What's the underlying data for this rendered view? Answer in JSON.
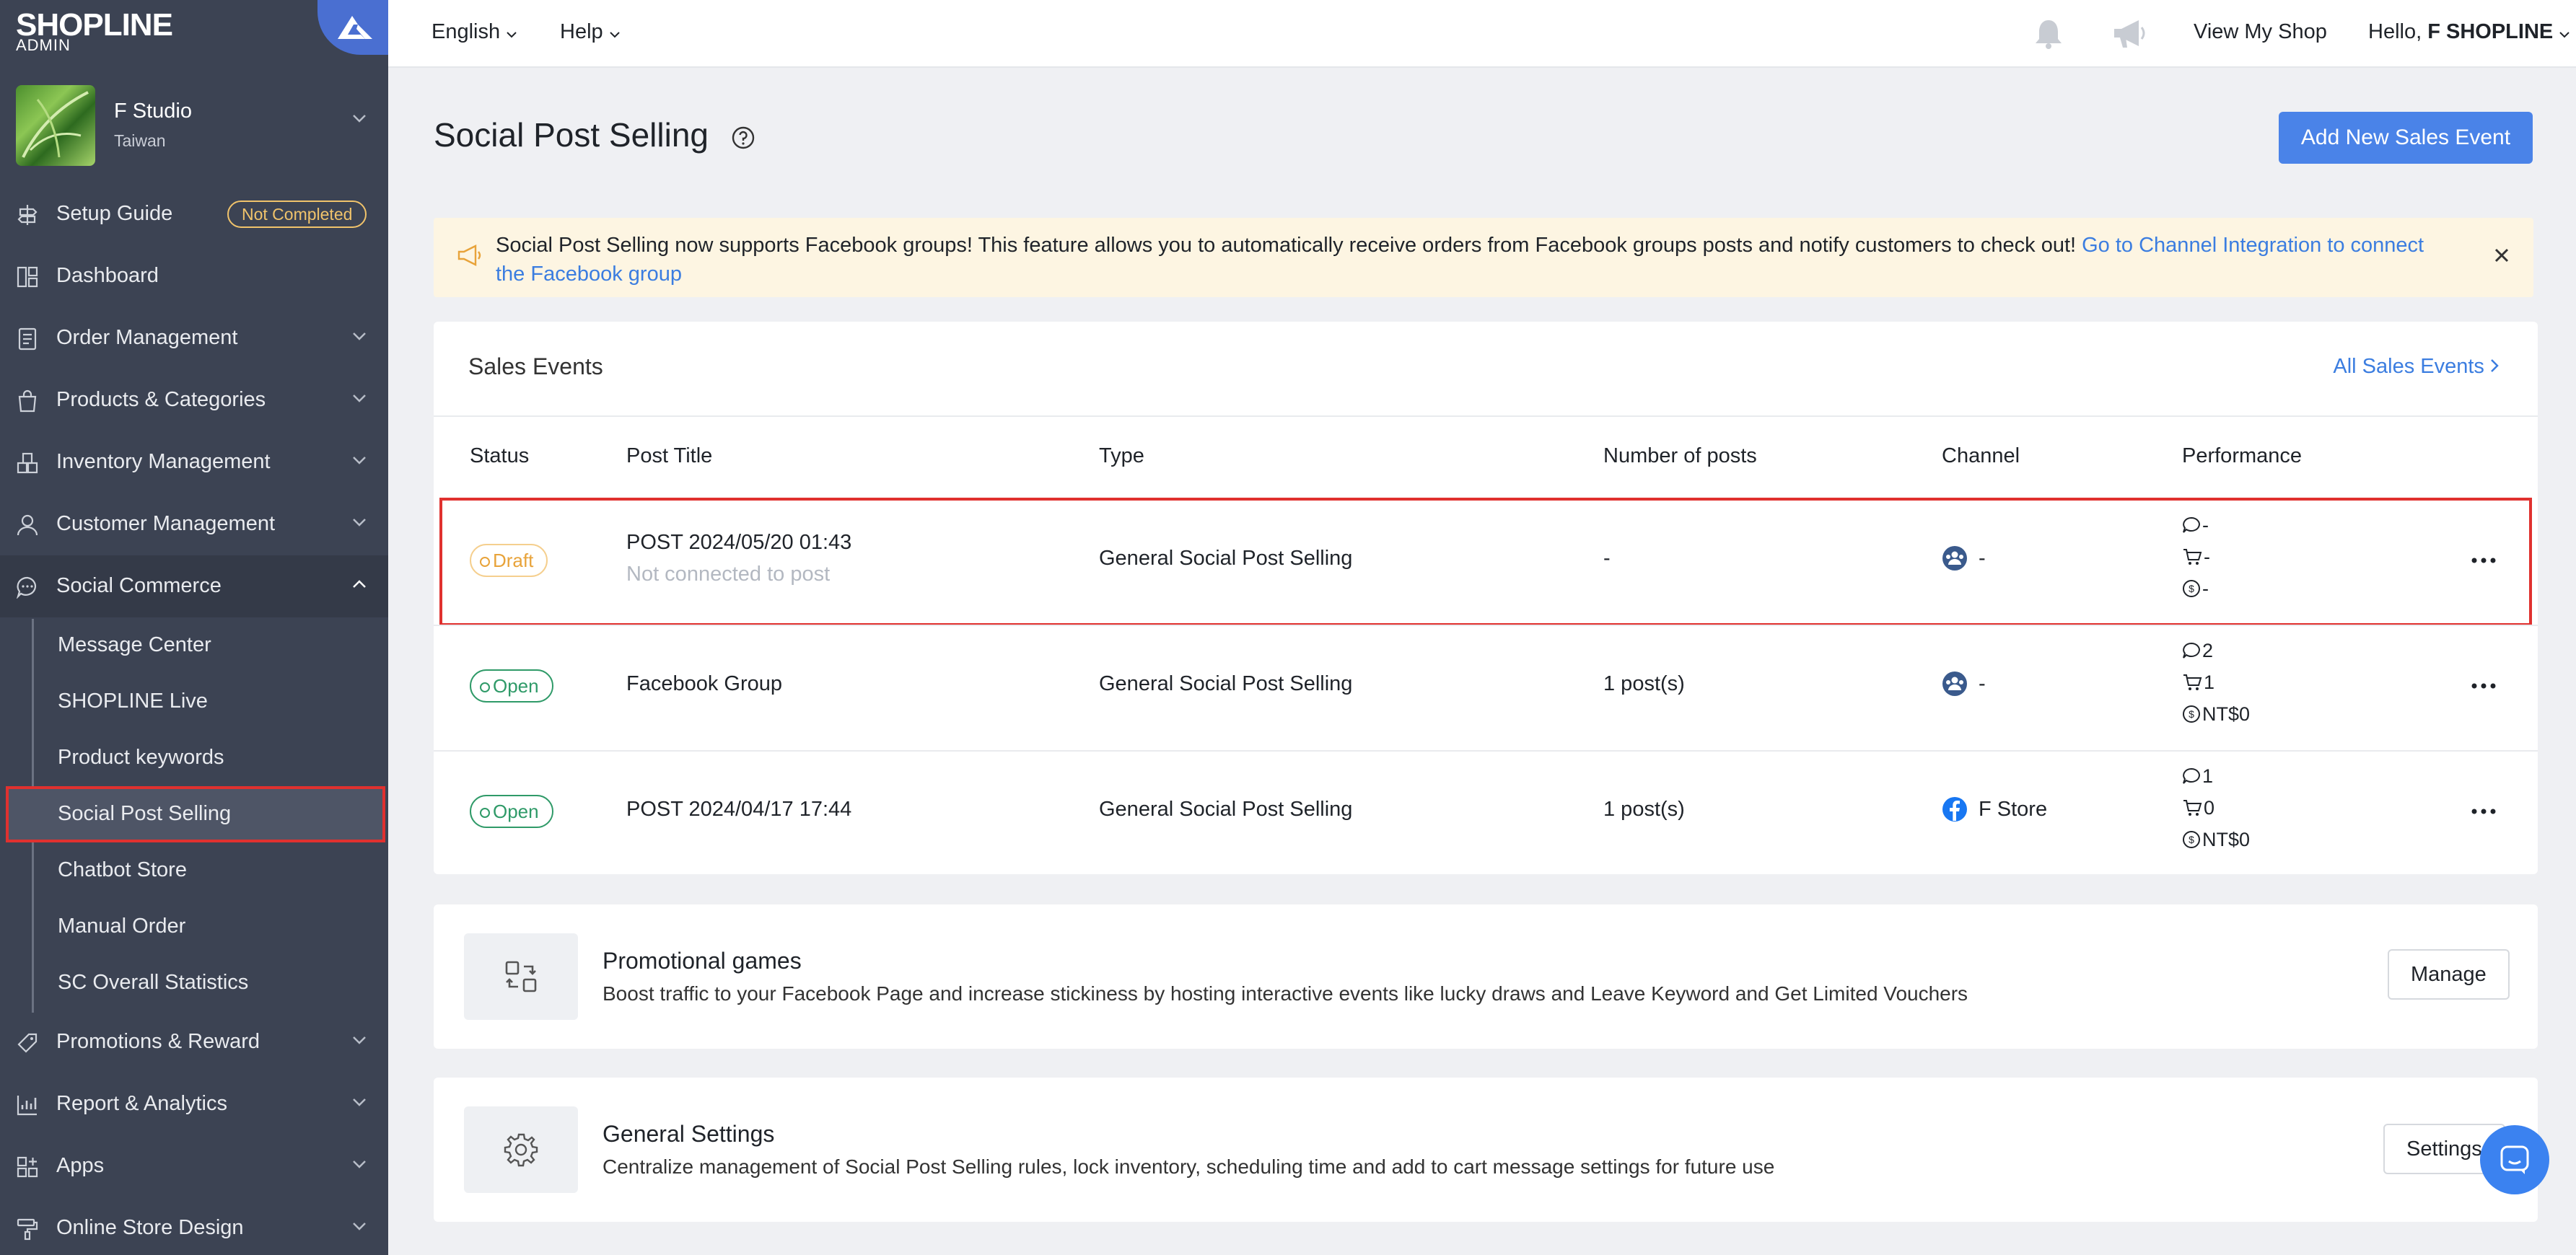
{
  "brand": {
    "logo": "SHOPLINE",
    "sub": "ADMIN",
    "accent": "#4a6fd1"
  },
  "shop": {
    "name": "F Studio",
    "location": "Taiwan"
  },
  "sidebar": {
    "setup_guide": {
      "label": "Setup Guide",
      "badge": "Not Completed"
    },
    "items": [
      {
        "label": "Dashboard"
      },
      {
        "label": "Order Management"
      },
      {
        "label": "Products & Categories"
      },
      {
        "label": "Inventory Management"
      },
      {
        "label": "Customer Management"
      },
      {
        "label": "Social Commerce"
      },
      {
        "label": "Promotions & Reward"
      },
      {
        "label": "Report & Analytics"
      },
      {
        "label": "Apps"
      },
      {
        "label": "Online Store Design"
      }
    ],
    "sub_items": [
      {
        "label": "Message Center"
      },
      {
        "label": "SHOPLINE Live"
      },
      {
        "label": "Product keywords"
      },
      {
        "label": "Social Post Selling"
      },
      {
        "label": "Chatbot Store"
      },
      {
        "label": "Manual Order"
      },
      {
        "label": "SC Overall Statistics"
      }
    ]
  },
  "topbar": {
    "language": "English",
    "help": "Help",
    "view_shop": "View My Shop",
    "greeting": "Hello,",
    "user": "F SHOPLINE"
  },
  "page": {
    "title": "Social Post Selling",
    "add_button": "Add New Sales Event",
    "banner_text": "Social Post Selling now supports Facebook groups! This feature allows you to automatically receive orders from Facebook groups posts and notify customers to check out! ",
    "banner_link": "Go to Channel Integration to connect the Facebook group"
  },
  "sales_events": {
    "title": "Sales Events",
    "all_link": "All Sales Events",
    "columns": [
      "Status",
      "Post Title",
      "Type",
      "Number of posts",
      "Channel",
      "Performance"
    ],
    "rows": [
      {
        "status": "Draft",
        "title": "POST 2024/05/20 01:43",
        "subtitle": "Not connected to post",
        "type": "General Social Post Selling",
        "posts": "-",
        "channel": "-",
        "comments": "-",
        "carts": "-",
        "revenue": "-"
      },
      {
        "status": "Open",
        "title": "Facebook Group",
        "subtitle": "",
        "type": "General Social Post Selling",
        "posts": "1 post(s)",
        "channel": "-",
        "comments": "2",
        "carts": "1",
        "revenue": "NT$0"
      },
      {
        "status": "Open",
        "title": "POST 2024/04/17 17:44",
        "subtitle": "",
        "type": "General Social Post Selling",
        "posts": "1 post(s)",
        "channel": "F Store",
        "comments": "1",
        "carts": "0",
        "revenue": "NT$0"
      }
    ]
  },
  "promo": {
    "title": "Promotional games",
    "desc": "Boost traffic to your Facebook Page and increase stickiness by hosting interactive events like lucky draws and Leave Keyword and Get Limited Vouchers",
    "button": "Manage"
  },
  "general": {
    "title": "General Settings",
    "desc": "Centralize management of Social Post Selling rules, lock inventory, scheduling time and add to cart message settings for future use",
    "button": "Settings"
  }
}
